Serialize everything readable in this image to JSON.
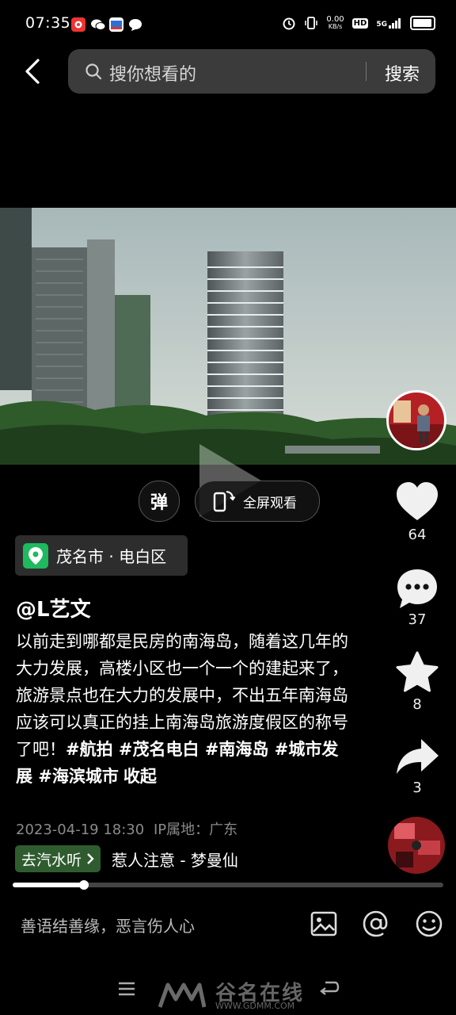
{
  "status_bar": {
    "time": "07:35",
    "net_speed_top": "0.00",
    "net_speed_bottom": "KB/s",
    "hd_label": "HD",
    "signal_label": "5G"
  },
  "search": {
    "placeholder": "搜你想看的",
    "button_label": "搜索"
  },
  "video_controls": {
    "danmu_label": "弹",
    "fullscreen_label": "全屏观看"
  },
  "location": {
    "text": "茂名市 · 电白区"
  },
  "post": {
    "author": "@L艺文",
    "description": "以前走到哪都是民房的南海岛，随着这几年的大力发展，高楼小区也一个一个的建起来了，旅游景点也在大力的发展中，不出五年南海岛应该可以真正的挂上南海岛旅游度假区的称号了吧！",
    "hashtags": "#航拍 #茂名电白 #南海岛 #城市发展 #海滨城市",
    "collapse_label": "收起",
    "datetime": "2023-04-19 18:30",
    "ip_location": "IP属地：广东"
  },
  "music": {
    "tag_label": "去汽水听",
    "song": "惹人注意 - 梦曼仙"
  },
  "actions": {
    "likes": "64",
    "comments": "37",
    "favorites": "8",
    "shares": "3"
  },
  "playback": {
    "progress_fraction": 0.165
  },
  "comment_box": {
    "placeholder": "善语结善缘，恶言伤人心"
  },
  "watermark": {
    "brand": "谷名在线",
    "url": "WWW.GDMM.COM"
  },
  "colors": {
    "location_pin": "#1fb95f",
    "music_tag_bg": "#2f5c2f",
    "search_bg": "#3b3b3b"
  }
}
